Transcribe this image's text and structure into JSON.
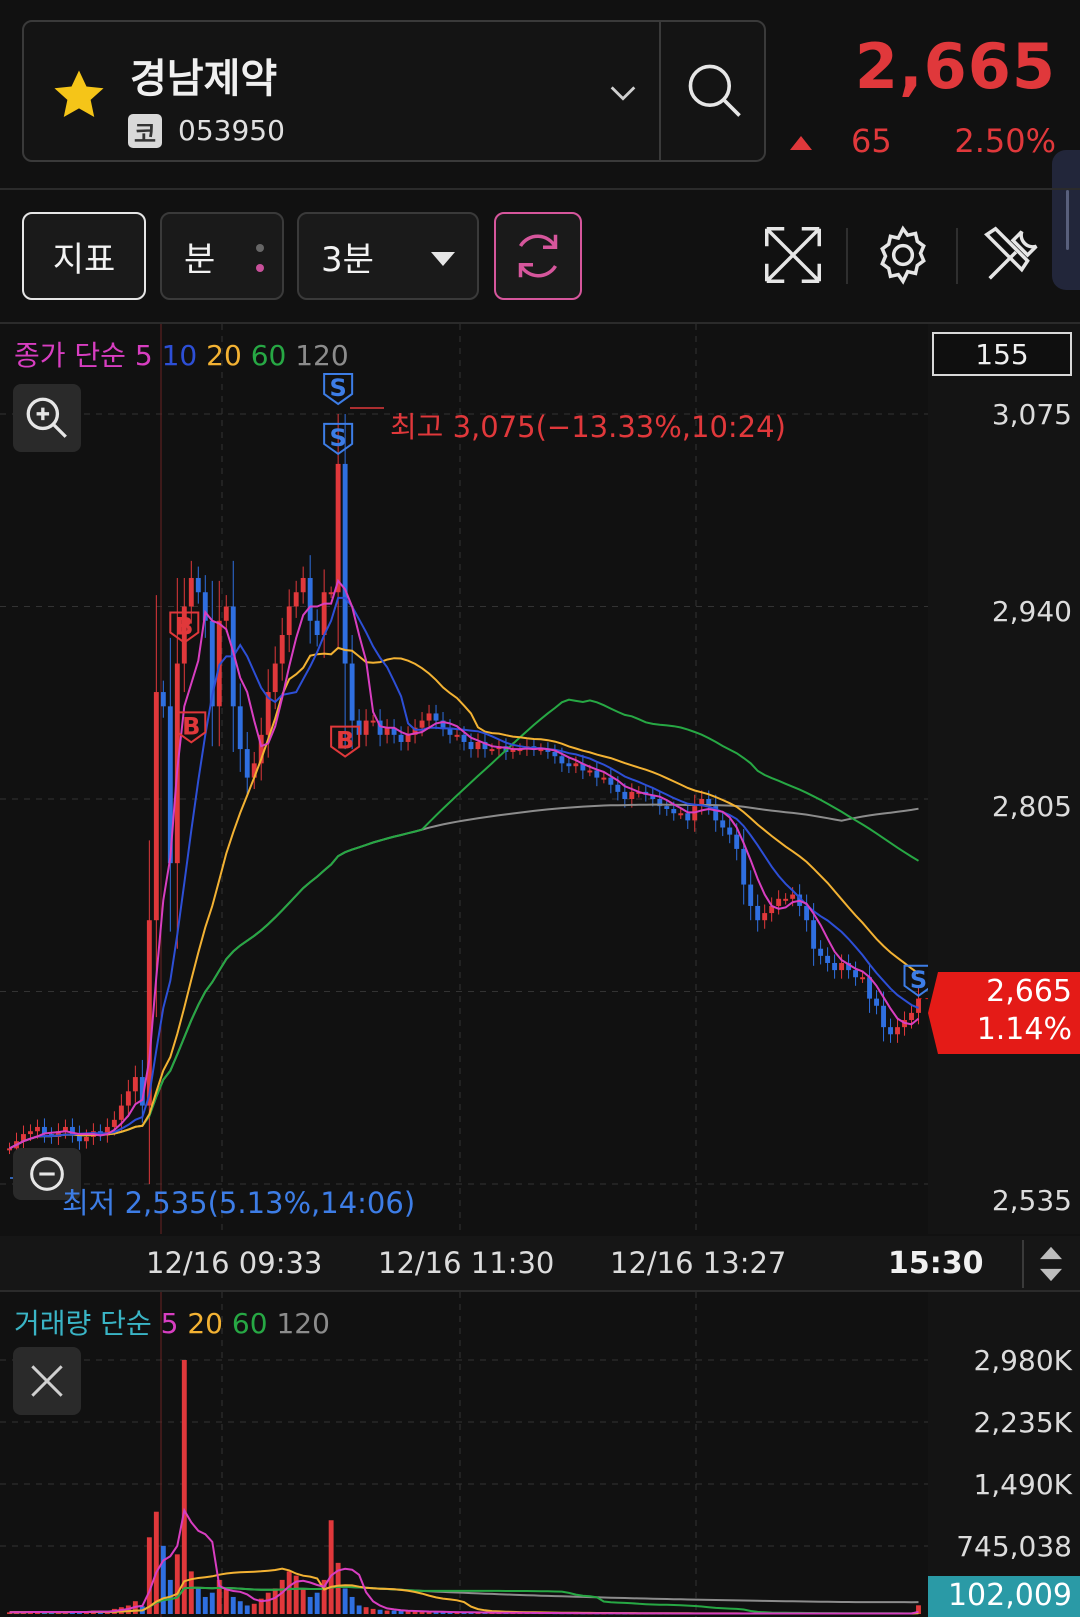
{
  "header": {
    "stock_name": "경남제약",
    "market_badge": "코",
    "stock_code": "053950",
    "price": "2,665",
    "change_value": "65",
    "change_percent": "2.50%"
  },
  "toolbar": {
    "indicator_label": "지표",
    "interval_type": "분",
    "period_label": "3분"
  },
  "chart": {
    "legend": {
      "prefix": "종가 단순",
      "ma5": "5",
      "ma10": "10",
      "ma20": "20",
      "ma60": "60",
      "ma120": "120"
    },
    "visible_count": "155",
    "y_ticks": [
      "3,075",
      "2,940",
      "2,805",
      "2,535"
    ],
    "current_price": "2,665",
    "current_change": "1.14%",
    "high_label": "최고 3,075(−13.33%,10:24)",
    "low_label": "최저 2,535(5.13%,14:06)",
    "x_ticks": [
      "12/16 09:33",
      "12/16 11:30",
      "12/16 13:27"
    ],
    "x_last": "15:30",
    "colors": {
      "up": "#e0383b",
      "down": "#2f6fe0",
      "ma5": "#d83ec1",
      "ma10": "#2d4fd6",
      "ma20": "#f3b233",
      "ma60": "#27a844",
      "ma120": "#8c8c8c"
    }
  },
  "volume": {
    "legend": {
      "prefix": "거래량 단순",
      "ma5": "5",
      "ma20": "20",
      "ma60": "60",
      "ma120": "120"
    },
    "y_ticks": [
      "2,980K",
      "2,235K",
      "1,490K",
      "745,038"
    ],
    "current": "102,009"
  },
  "chart_data": {
    "type": "candlestick",
    "y_range": [
      2535,
      3075
    ],
    "x_labels": [
      "12/16 09:33",
      "12/16 11:30",
      "12/16 13:27",
      "15:30"
    ],
    "close": [
      2560,
      2565,
      2570,
      2572,
      2575,
      2570,
      2568,
      2572,
      2575,
      2570,
      2565,
      2568,
      2572,
      2570,
      2575,
      2580,
      2590,
      2600,
      2610,
      2590,
      2720,
      2880,
      2870,
      2760,
      2900,
      2940,
      2960,
      2950,
      2930,
      2870,
      2930,
      2940,
      2870,
      2840,
      2820,
      2830,
      2850,
      2880,
      2900,
      2920,
      2940,
      2950,
      2960,
      2930,
      2920,
      2950,
      2950,
      3040,
      2900,
      2860,
      2850,
      2860,
      2860,
      2850,
      2855,
      2850,
      2845,
      2850,
      2855,
      2860,
      2865,
      2860,
      2855,
      2850,
      2850,
      2845,
      2840,
      2845,
      2840,
      2840,
      2842,
      2838,
      2840,
      2840,
      2842,
      2840,
      2840,
      2838,
      2835,
      2830,
      2828,
      2830,
      2825,
      2825,
      2820,
      2820,
      2815,
      2810,
      2805,
      2810,
      2810,
      2808,
      2805,
      2800,
      2798,
      2795,
      2795,
      2790,
      2800,
      2805,
      2800,
      2790,
      2785,
      2780,
      2770,
      2745,
      2730,
      2720,
      2725,
      2730,
      2735,
      2735,
      2738,
      2730,
      2720,
      2700,
      2695,
      2690,
      2685,
      2690,
      2685,
      2680,
      2680,
      2665,
      2660,
      2645,
      2640,
      2645,
      2650,
      2655,
      2665
    ],
    "volume_values": [
      20000,
      25000,
      18000,
      30000,
      22000,
      20000,
      25000,
      18000,
      22000,
      30000,
      25000,
      20000,
      40000,
      30000,
      25000,
      60000,
      80000,
      100000,
      150000,
      90000,
      900000,
      1200000,
      800000,
      400000,
      700000,
      2980000,
      500000,
      300000,
      200000,
      250000,
      400000,
      300000,
      200000,
      150000,
      100000,
      120000,
      180000,
      250000,
      300000,
      400000,
      500000,
      450000,
      300000,
      200000,
      250000,
      400000,
      1100000,
      600000,
      300000,
      200000,
      100000,
      80000,
      60000,
      50000,
      40000,
      40000,
      35000,
      30000,
      30000,
      28000,
      25000,
      25000,
      22000,
      20000,
      20000,
      18000,
      18000,
      16000,
      15000,
      15000,
      14000,
      14000,
      13000,
      12000,
      12000,
      12000,
      11000,
      11000,
      10000,
      10000,
      10000,
      9000,
      9000,
      9000,
      8000,
      8000,
      8000,
      8000,
      7000,
      7000,
      7000,
      7000,
      7000,
      6000,
      6000,
      6000,
      6000,
      6000,
      6000,
      6000,
      6000,
      6000,
      6000,
      6000,
      6000,
      6000,
      6000,
      6000,
      6000,
      6000,
      6000,
      6000,
      6000,
      6000,
      6000,
      6000,
      6000,
      6000,
      6000,
      6000,
      6000,
      6000,
      6000,
      6000,
      6000,
      6000,
      6000,
      6000,
      6000,
      6000,
      102009
    ],
    "volume_range": [
      0,
      2980000
    ],
    "series": [
      {
        "name": "5",
        "color": "#d83ec1"
      },
      {
        "name": "10",
        "color": "#2d4fd6"
      },
      {
        "name": "20",
        "color": "#f3b233"
      },
      {
        "name": "60",
        "color": "#27a844"
      },
      {
        "name": "120",
        "color": "#8c8c8c"
      }
    ]
  }
}
